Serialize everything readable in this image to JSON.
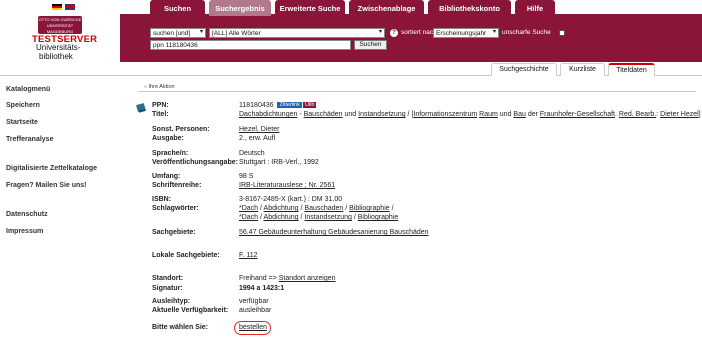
{
  "flags": [
    "flag-de",
    "flag-en"
  ],
  "nav_tabs": [
    "Suchen",
    "Suchergebnis",
    "Erweiterte Suche",
    "Zwischenablage",
    "Bibliothekskonto",
    "Hilfe"
  ],
  "active_tab": "Suchergebnis",
  "logo": {
    "top_text": "OTTO VON GUERICKE UNIVERSITÄT MAGDEBURG",
    "testserver": "TESTSERVER",
    "line1": "Universitäts-",
    "line2": "bibliothek"
  },
  "search": {
    "mode_select": "suchen [und]",
    "field_select": "[ALL] Alle Wörter",
    "query_value": "ppn 118180436",
    "submit_label": "Suchen",
    "sort_label": "sortiert nach",
    "sort_select": "Erscheinungsjahr",
    "fuzzy_label": "unscharfe Suche"
  },
  "sub_tabs": [
    "Suchgeschichte",
    "Kurzliste",
    "Titeldaten"
  ],
  "sidebar": [
    "Katalogmenü",
    "Speichern",
    "Startseite",
    "Trefferanalyse",
    "Digitalisierte Zettelkataloge",
    "Fragen? Mailen Sie uns!",
    "Datenschutz",
    "Impressum"
  ],
  "action_label": "Ihre Aktion",
  "record": {
    "ppn_label": "PPN:",
    "ppn": "118180436",
    "badge_zitier": "Zitierlink",
    "badge_ulib": "Ulib",
    "title_label": "Titel:",
    "title_parts": [
      "Dachabdichtungen",
      " - ",
      "Bauschäden",
      " und ",
      "Instandsetzung",
      " / [",
      "Informationszentrum",
      " ",
      "Raum",
      " und ",
      "Bau",
      " der ",
      "Fraunhofer-Gesellschaft",
      ". ",
      "Red. Bearb.",
      ": ",
      "Dieter Hezel",
      "]"
    ],
    "rows": [
      {
        "label": "Sonst. Personen:",
        "value": "Hezel, Dieter",
        "link": true
      },
      {
        "label": "Ausgabe:",
        "value": "2., erw. Aufl",
        "link": false
      },
      {
        "label": "Sprache/n:",
        "value": "Deutsch",
        "link": false
      },
      {
        "label": "Veröffentlichungsangabe:",
        "value": "Stuttgart : IRB-Verl., 1992",
        "link": false
      },
      {
        "label": "Umfang:",
        "value": "98 S",
        "link": false
      },
      {
        "label": "Schriftenreihe:",
        "value": "IRB-Literaturauslese ; Nr. 2561",
        "link": true
      },
      {
        "label": "ISBN:",
        "value": "3-8167-2485-X (kart.) : DM 31.00",
        "link": false
      }
    ],
    "schlagwoerter_label": "Schlagwörter:",
    "schlagwoerter": [
      [
        "*Dach",
        "Abdichtung",
        "Bauschaden",
        "Bibliographie"
      ],
      [
        "*Dach",
        "Abdichtung",
        "Instandsetzung",
        "Bibliographie"
      ]
    ],
    "sachgebiete_label": "Sachgebiete:",
    "sachgebiete": "56.47 Gebäudeunterhaltung Gebäudesanierung Bauschäden",
    "lokale_label": "Lokale Sachgebiete:",
    "lokale": "F. 112",
    "standort_label": "Standort:",
    "standort_text": "Freihand => ",
    "standort_link": "Standort anzeigen",
    "signatur_label": "Signatur:",
    "signatur": "1994 a 1423:1",
    "ausleihtyp_label": "Ausleihtyp:",
    "ausleihtyp": "verfügbar",
    "verfuegbarkeit_label": "Aktuelle Verfügbarkeit:",
    "verfuegbarkeit": "ausleihbar",
    "bitte_label": "Bitte wählen Sie:",
    "bestellen": "bestellen"
  },
  "colors": {
    "maroon": "#8a1538",
    "active_tab": "#b07a8c",
    "highlight": "#e0262b"
  }
}
